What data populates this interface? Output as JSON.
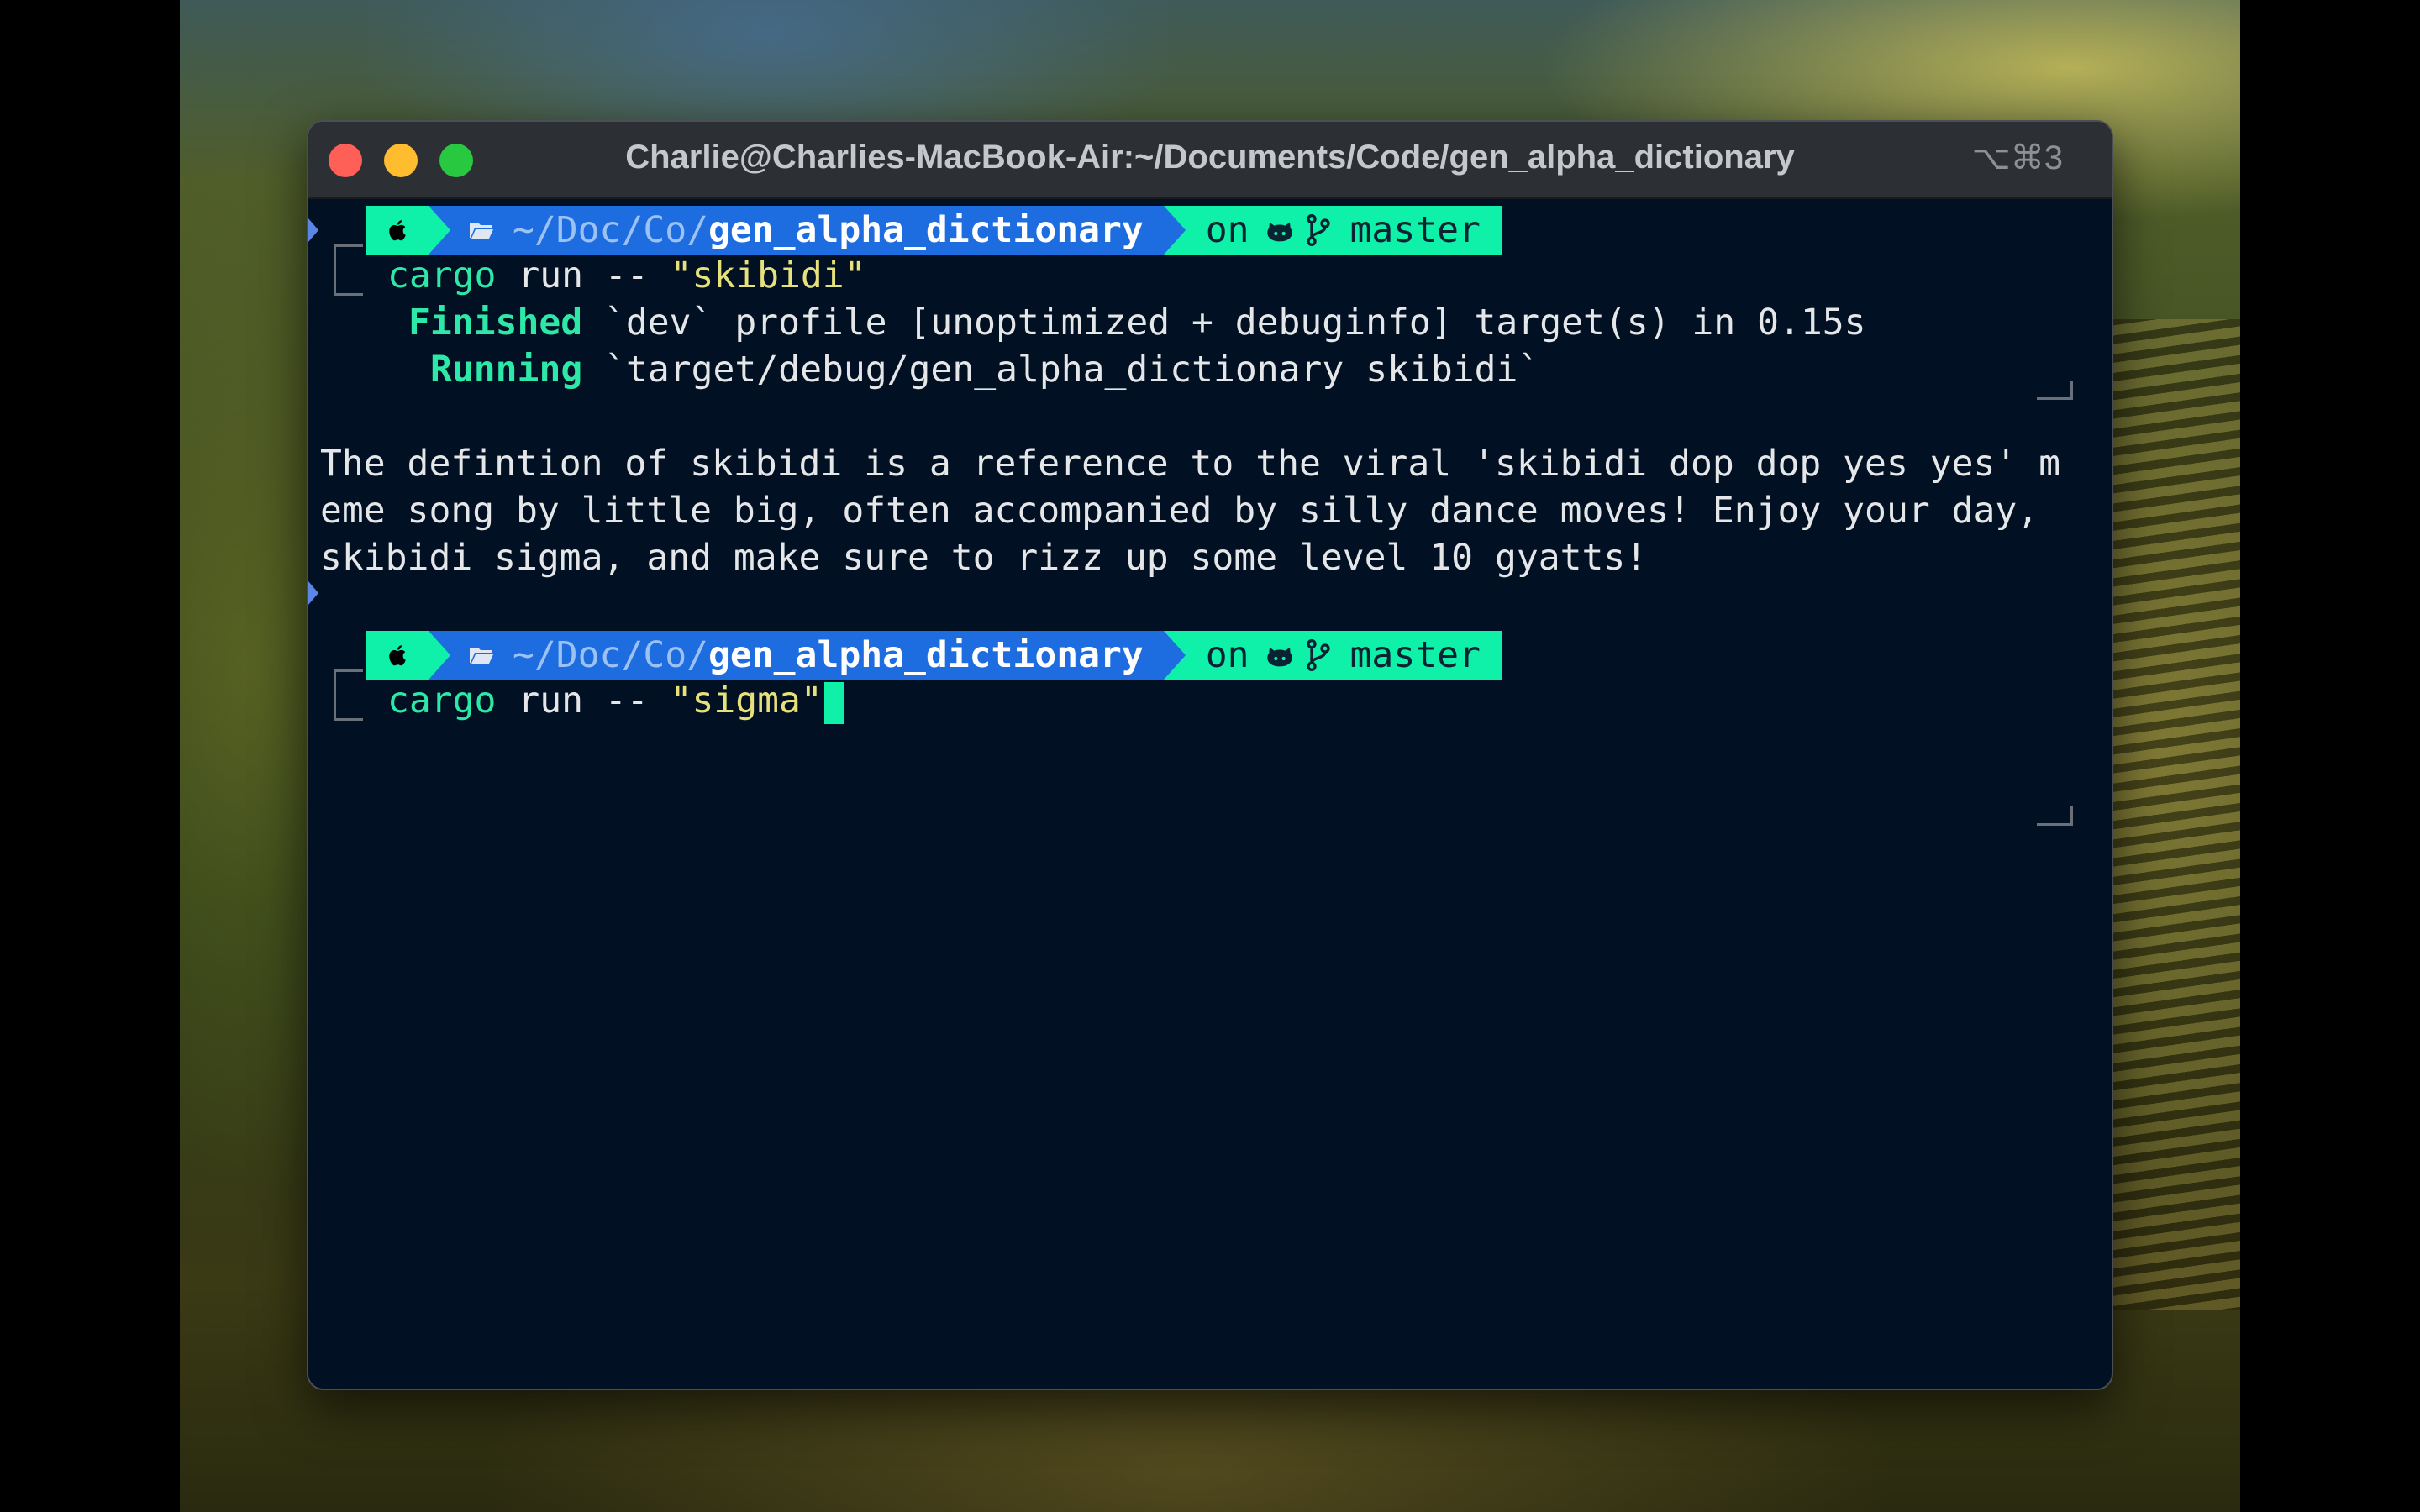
{
  "window": {
    "title": "Charlie@Charlies-MacBook-Air:~/Documents/Code/gen_alpha_dictionary",
    "shortcut": "⌥⌘3"
  },
  "prompt": {
    "path_prefix": "~/Doc/Co/",
    "path_dir": "gen_alpha_dictionary",
    "on_label": "on",
    "branch": "master"
  },
  "session": {
    "cmd1": {
      "program": "cargo",
      "args": " run -- ",
      "quoted": "\"skibidi\""
    },
    "finished": {
      "label": "Finished",
      "text": " `dev` profile [unoptimized + debuginfo] target(s) in 0.15s"
    },
    "running": {
      "label": "Running",
      "text": " `target/debug/gen_alpha_dictionary skibidi`"
    },
    "output": [
      "The defintion of skibidi is a reference to the viral 'skibidi dop dop yes yes' m",
      "eme song by little big, often accompanied by silly dance moves! Enjoy your day,",
      "skibidi sigma, and make sure to rizz up some level 10 gyatts!"
    ],
    "cmd2": {
      "program": "cargo",
      "args": " run -- ",
      "quoted": "\"sigma\""
    }
  },
  "colors": {
    "prompt_green": "#0ff0a8",
    "prompt_blue": "#1e6de0",
    "terminal_bg": "#011022"
  },
  "icons": [
    "apple-icon",
    "folder-icon",
    "github-icon",
    "git-branch-icon"
  ]
}
